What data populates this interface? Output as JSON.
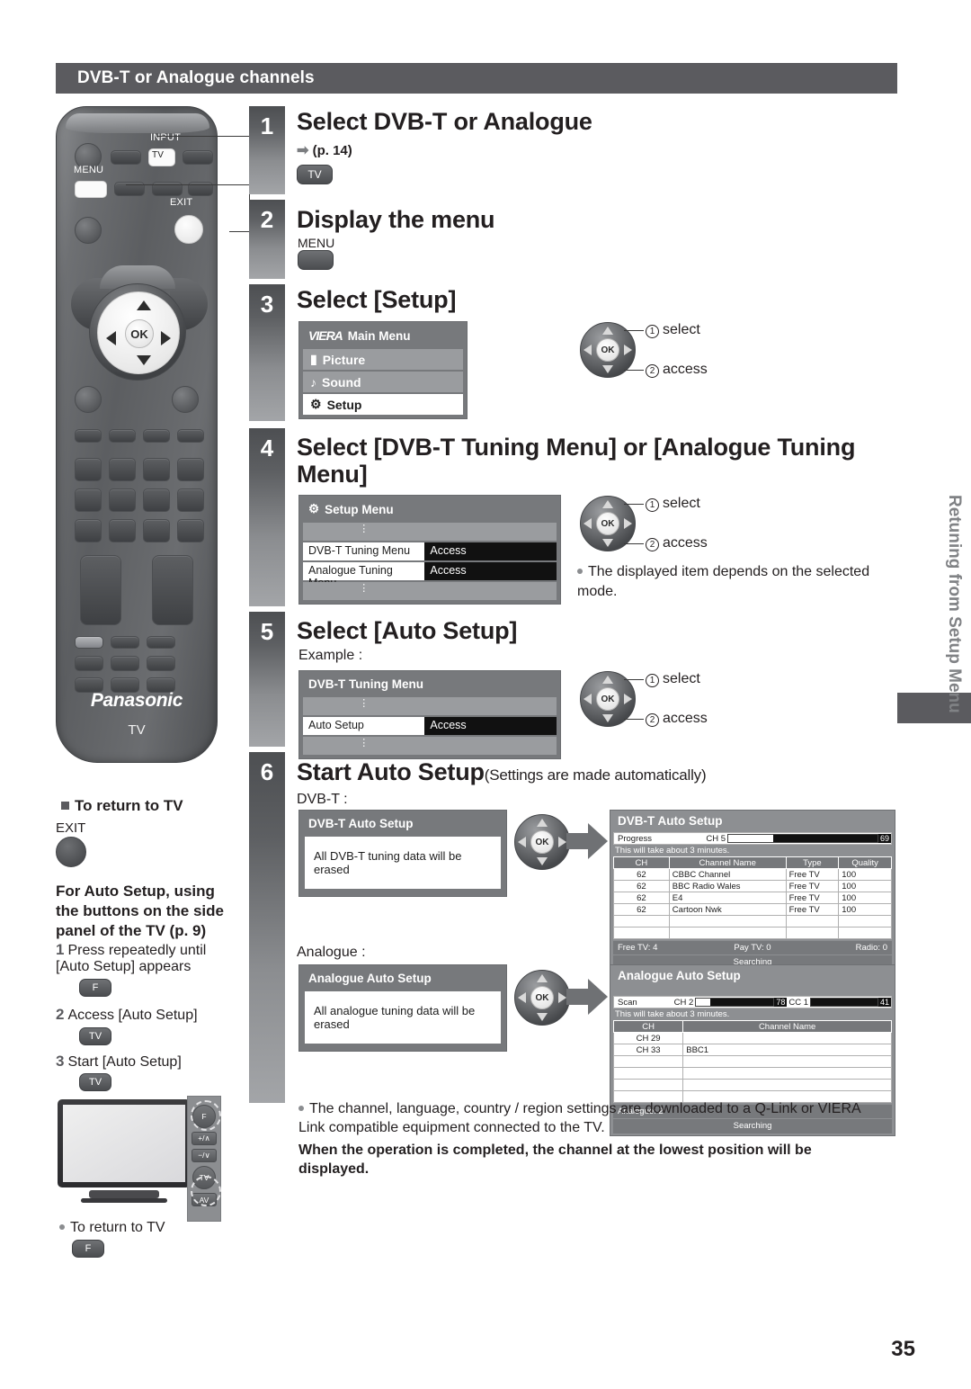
{
  "section": {
    "title": "DVB-T or Analogue channels"
  },
  "remote": {
    "input_label": "INPUT",
    "tv_key": "TV",
    "menu_label": "MENU",
    "exit_label": "EXIT",
    "ok_label": "OK",
    "brand": "Panasonic",
    "brand_sub": "TV"
  },
  "steps": [
    {
      "num": "1",
      "heading": "Select DVB-T or Analogue",
      "page_ref": "(p. 14)",
      "key": "TV"
    },
    {
      "num": "2",
      "heading": "Display the menu",
      "key_label": "MENU"
    },
    {
      "num": "3",
      "heading": "Select [Setup]",
      "menu": {
        "brand": "VIERA",
        "title": "Main Menu",
        "items": [
          {
            "label": "Picture",
            "icon": "picture-icon",
            "selected": false
          },
          {
            "label": "Sound",
            "icon": "sound-icon",
            "selected": false
          },
          {
            "label": "Setup",
            "icon": "setup-icon",
            "selected": true
          }
        ]
      },
      "callouts": [
        {
          "num": "1",
          "text": "select"
        },
        {
          "num": "2",
          "text": "access"
        }
      ]
    },
    {
      "num": "4",
      "heading": "Select [DVB-T Tuning Menu] or [Analogue Tuning Menu]",
      "menu": {
        "title": "Setup Menu",
        "rows": [
          {
            "name": "DVB-T Tuning Menu",
            "value": "Access",
            "selected": true
          },
          {
            "name": "Analogue Tuning Menu",
            "value": "Access",
            "selected": true
          }
        ]
      },
      "callouts": [
        {
          "num": "1",
          "text": "select"
        },
        {
          "num": "2",
          "text": "access"
        }
      ],
      "note": "The displayed item depends on the selected mode."
    },
    {
      "num": "5",
      "heading": "Select [Auto Setup]",
      "example_label": "Example :",
      "menu": {
        "title": "DVB-T Tuning Menu",
        "rows": [
          {
            "name": "Auto Setup",
            "value": "Access",
            "selected": true
          }
        ]
      },
      "callouts": [
        {
          "num": "1",
          "text": "select"
        },
        {
          "num": "2",
          "text": "access"
        }
      ]
    },
    {
      "num": "6",
      "heading": "Start Auto Setup",
      "heading_small": "(Settings are made automatically)"
    }
  ],
  "dvbt": {
    "mode_label": "DVB-T :",
    "confirm": {
      "title": "DVB-T Auto Setup",
      "message": "All DVB-T tuning data will be erased"
    },
    "result": {
      "title": "DVB-T Auto Setup",
      "progress_label": "Progress",
      "channel_label": "CH 5",
      "progress_value": "69",
      "progress_percent": 30,
      "time_note": "This will take about 3 minutes.",
      "columns": [
        "CH",
        "Channel Name",
        "Type",
        "Quality"
      ],
      "rows": [
        [
          "62",
          "CBBC Channel",
          "Free TV",
          "100"
        ],
        [
          "62",
          "BBC Radio Wales",
          "Free TV",
          "100"
        ],
        [
          "62",
          "E4",
          "Free TV",
          "100"
        ],
        [
          "62",
          "Cartoon Nwk",
          "Free TV",
          "100"
        ],
        [
          "",
          "",
          "",
          ""
        ],
        [
          "",
          "",
          "",
          ""
        ]
      ],
      "footer": [
        "Free TV: 4",
        "Pay TV: 0",
        "Radio: 0"
      ],
      "status": "Searching"
    }
  },
  "analogue": {
    "mode_label": "Analogue :",
    "confirm": {
      "title": "Analogue Auto Setup",
      "message": "All analogue tuning data will be erased"
    },
    "result": {
      "title": "Analogue Auto Setup",
      "scan_label": "Scan",
      "ch_label": "CH 2",
      "ch_value": "78",
      "ch_percent": 18,
      "cc_label": "CC 1",
      "cc_value": "41",
      "cc_percent": 0,
      "time_note": "This will take about 3 minutes.",
      "columns": [
        "CH",
        "Channel Name"
      ],
      "rows": [
        [
          "CH 29",
          ""
        ],
        [
          "CH 33",
          "BBC1"
        ],
        [
          "",
          ""
        ],
        [
          "",
          ""
        ],
        [
          "",
          ""
        ],
        [
          "",
          ""
        ]
      ],
      "footer": "Analogue: 2",
      "status": "Searching"
    }
  },
  "left_block": {
    "return_title": "To return to TV",
    "exit_label": "EXIT",
    "side_panel_title": "For Auto Setup, using the buttons on the side panel of the TV (p. 9)",
    "steps": [
      {
        "n": "1",
        "text": "Press repeatedly until [Auto Setup] appears",
        "key": "F"
      },
      {
        "n": "2",
        "text": "Access [Auto Setup]",
        "key": "TV"
      },
      {
        "n": "3",
        "text": "Start [Auto Setup]",
        "key": "TV"
      }
    ],
    "side_keys": [
      "F",
      "+/∧",
      "−/∨",
      "TV",
      "AV"
    ],
    "return_note": "To return to TV",
    "return_note_key": "F"
  },
  "footer_notes": {
    "note1": "The channel, language, country / region settings are downloaded to a Q-Link or VIERA Link compatible equipment connected to the TV.",
    "note2": "When the operation is completed, the channel at the lowest position will be displayed."
  },
  "side_tab": {
    "text": "Retuning from Setup Menu"
  },
  "page_number": "35"
}
